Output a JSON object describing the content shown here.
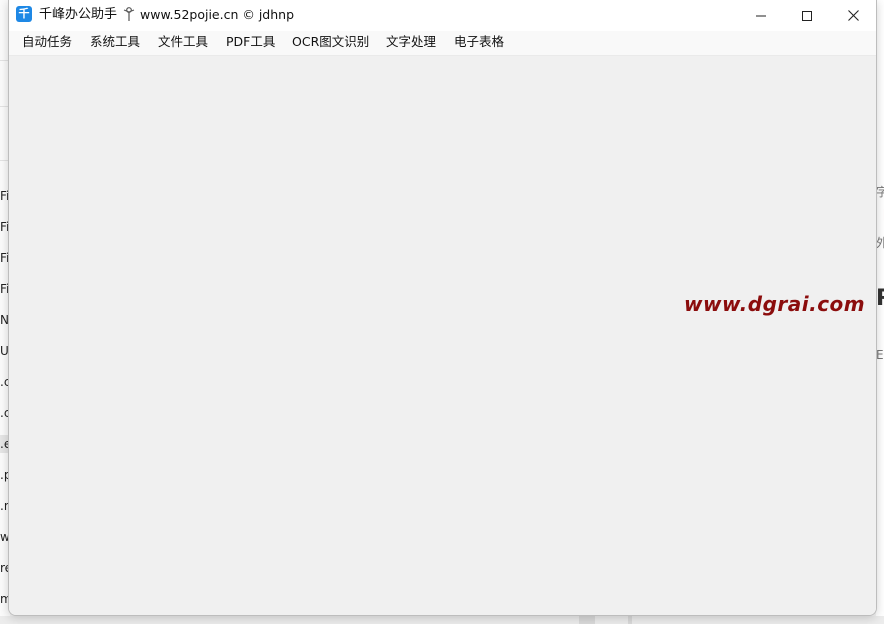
{
  "window": {
    "app_icon_glyph": "千",
    "title": "千峰办公助手",
    "site": "www.52pojie.cn © jdhnp",
    "controls": {
      "minimize": "minimize-icon",
      "maximize": "maximize-icon",
      "close": "close-icon"
    }
  },
  "menubar": {
    "items": [
      "自动任务",
      "系统工具",
      "文件工具",
      "PDF工具",
      "OCR图文识别",
      "文字处理",
      "电子表格"
    ]
  },
  "watermark": "www.dgrai.com",
  "background": {
    "left_items": [
      "Fi",
      "Fi",
      "Fi",
      "Fi",
      "N",
      "U",
      ".c",
      ".c",
      ".e",
      ".p",
      ".n",
      "w",
      "re",
      "m"
    ],
    "right_fragments": [
      "字",
      "【",
      "外",
      "R",
      "E,"
    ]
  },
  "colors": {
    "accent": "#1e88e5",
    "watermark": "#8b0d0d",
    "window_bg": "#f0f0f0"
  }
}
